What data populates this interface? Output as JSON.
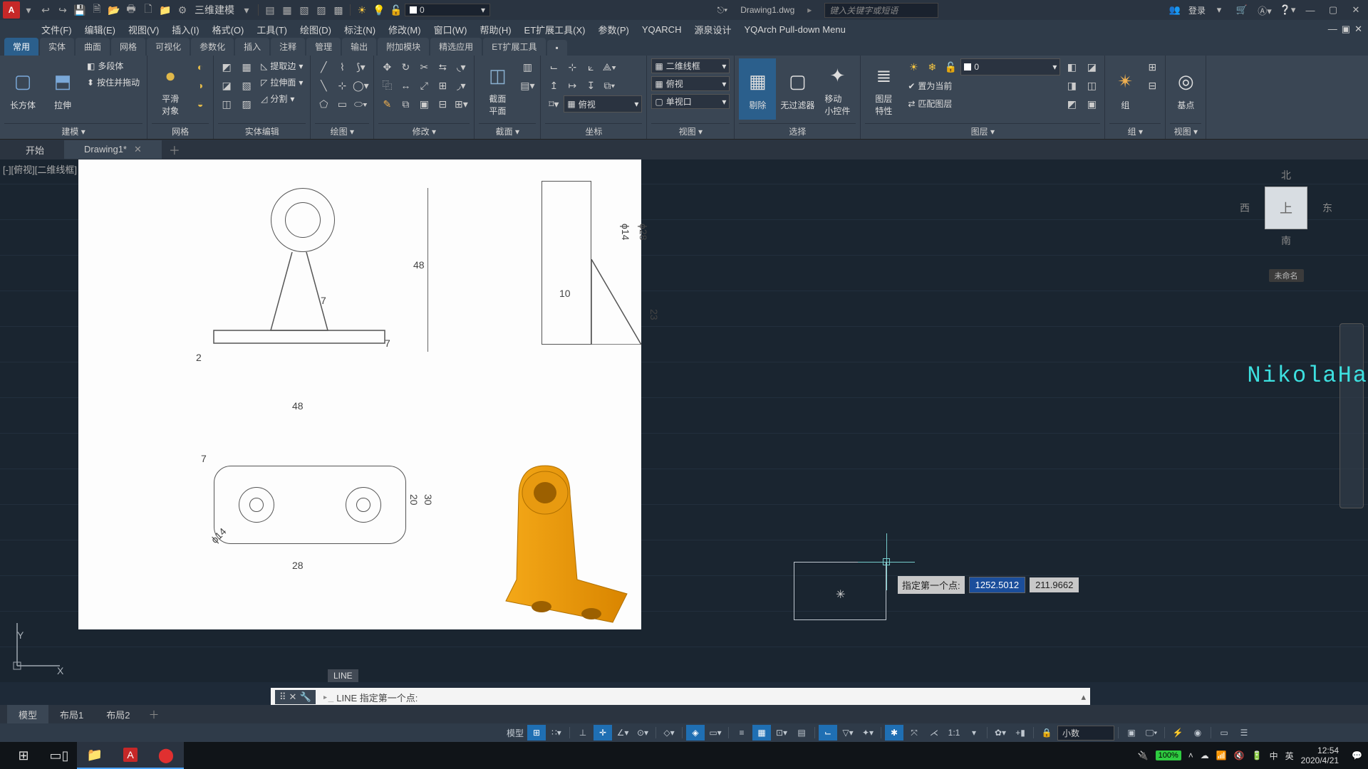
{
  "title_bar": {
    "app_initial": "A",
    "workspace": "三维建模",
    "filename": "Drawing1.dwg",
    "search_placeholder": "键入关键字或短语",
    "login_label": "登录",
    "layer_prefix": "0"
  },
  "menu": {
    "items": [
      "文件(F)",
      "编辑(E)",
      "视图(V)",
      "插入(I)",
      "格式(O)",
      "工具(T)",
      "绘图(D)",
      "标注(N)",
      "修改(M)",
      "窗口(W)",
      "帮助(H)",
      "ET扩展工具(X)",
      "参数(P)",
      "YQARCH",
      "源泉设计",
      "YQArch Pull-down Menu"
    ]
  },
  "ribbon_tabs": [
    "常用",
    "实体",
    "曲面",
    "网格",
    "可视化",
    "参数化",
    "插入",
    "注释",
    "管理",
    "输出",
    "附加模块",
    "精选应用",
    "ET扩展工具"
  ],
  "ribbon_tabs_active": 0,
  "panels": {
    "model": {
      "title": "建模 ▾",
      "box": "长方体",
      "extrude": "拉伸",
      "poly": "多段体",
      "press": "按住并拖动"
    },
    "grid": {
      "title": "网格",
      "smooth": "平滑\n对象"
    },
    "solid_edit": {
      "title": "实体编辑",
      "edge": "提取边",
      "stretch": "拉伸面",
      "split": "分割"
    },
    "draw": {
      "title": "绘图 ▾"
    },
    "modify": {
      "title": "修改 ▾"
    },
    "section": {
      "title": "截面 ▾",
      "plane": "截面\n平面"
    },
    "coord": {
      "title": "坐标"
    },
    "view_dd1": "二维线框",
    "view_dd2": "俯视",
    "view_dd3": "俯视",
    "view_dd4": "单视口",
    "view": {
      "title": "视图 ▾"
    },
    "select": {
      "title": "选择",
      "clear": "剔除",
      "nofilter": "无过滤器",
      "move": "移动\n小控件"
    },
    "layer": {
      "title": "图层 ▾",
      "props": "图层\n特性",
      "dd": "0",
      "makecur": "置为当前",
      "match": "匹配图层"
    },
    "group": {
      "title": "组 ▾",
      "grp": "组"
    },
    "viewp": {
      "title": "视图 ▾",
      "base": "基点"
    }
  },
  "doc_tabs": {
    "start": "开始",
    "drawing": "Drawing1*"
  },
  "viewport_label": "[-][俯视][二维线框]",
  "viewcube": {
    "n": "北",
    "s": "南",
    "e": "东",
    "w": "西",
    "top": "上",
    "unnamed": "未命名"
  },
  "watermark": "NikolaHa",
  "dyn": {
    "label": "指定第一个点:",
    "x": "1252.5012",
    "y": "211.9662"
  },
  "cmd_prev": "LINE",
  "cmd_line": "LINE 指定第一个点:",
  "layout_tabs": [
    "模型",
    "布局1",
    "布局2"
  ],
  "status": {
    "model": "模型",
    "scale": "1:1",
    "units": "小数"
  },
  "taskbar": {
    "time": "12:54",
    "date": "2020/4/21",
    "battery": "100%",
    "ime1": "中",
    "ime2": "英"
  },
  "dims": {
    "d48": "48",
    "d48b": "48",
    "d7": "7",
    "d7b": "7",
    "d2": "2",
    "d14": "ϕ14",
    "d28": "ϕ28",
    "d10": "10",
    "d23": "23",
    "d28b": "28",
    "d30": "30",
    "d20": "20",
    "d14b": "ϕ14",
    "d7c": "7"
  }
}
